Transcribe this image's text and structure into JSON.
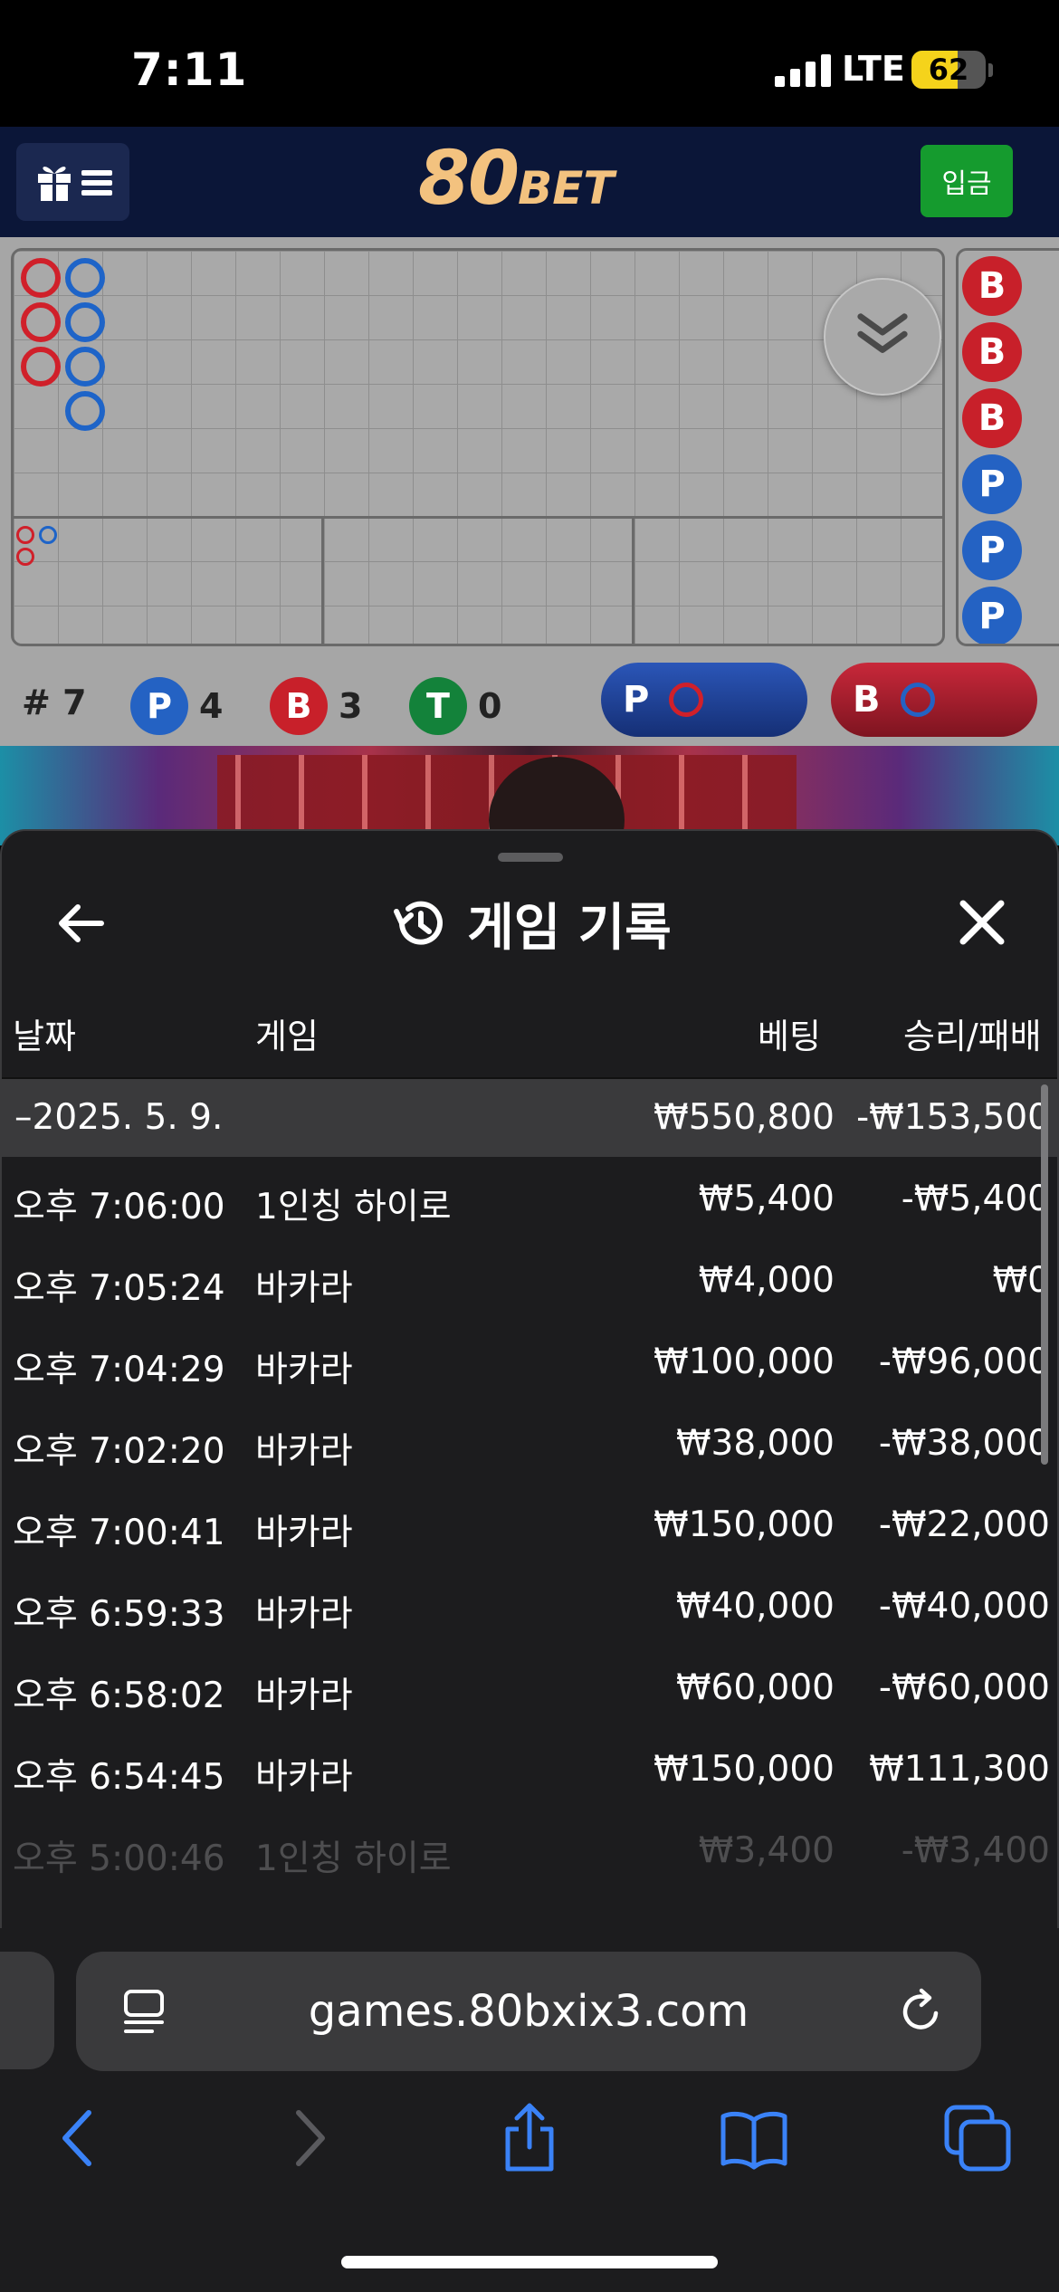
{
  "status_bar": {
    "time": "7:11",
    "network": "LTE",
    "battery": "62",
    "battery_level": 0.62
  },
  "header": {
    "logo_main": "80",
    "logo_sub": "BET",
    "deposit_label": "입금"
  },
  "roadmap": {
    "total_label": "# 7",
    "player": {
      "letter": "P",
      "count": "4"
    },
    "banker": {
      "letter": "B",
      "count": "3"
    },
    "tie": {
      "letter": "T",
      "count": "0"
    },
    "predict_player_label": "P",
    "predict_banker_label": "B",
    "bead_road": [
      "B",
      "B",
      "B",
      "P",
      "P",
      "P"
    ],
    "colors": {
      "banker": "#c8202a",
      "player": "#2462c3",
      "tie": "#13823a"
    }
  },
  "sheet": {
    "title": "게임 기록",
    "columns": {
      "date": "날짜",
      "game": "게임",
      "bet": "베팅",
      "result": "승리/패배"
    },
    "date_group": {
      "date": "–2025. 5. 9.",
      "bet": "₩550,800",
      "result": "-₩153,500"
    },
    "rows": [
      {
        "time": "오후 7:06:00",
        "game": "1인칭 하이로",
        "bet": "₩5,400",
        "result": "-₩5,400"
      },
      {
        "time": "오후 7:05:24",
        "game": "바카라",
        "bet": "₩4,000",
        "result": "₩0"
      },
      {
        "time": "오후 7:04:29",
        "game": "바카라",
        "bet": "₩100,000",
        "result": "-₩96,000"
      },
      {
        "time": "오후 7:02:20",
        "game": "바카라",
        "bet": "₩38,000",
        "result": "-₩38,000"
      },
      {
        "time": "오후 7:00:41",
        "game": "바카라",
        "bet": "₩150,000",
        "result": "-₩22,000"
      },
      {
        "time": "오후 6:59:33",
        "game": "바카라",
        "bet": "₩40,000",
        "result": "-₩40,000"
      },
      {
        "time": "오후 6:58:02",
        "game": "바카라",
        "bet": "₩60,000",
        "result": "-₩60,000"
      },
      {
        "time": "오후 6:54:45",
        "game": "바카라",
        "bet": "₩150,000",
        "result": "₩111,300"
      },
      {
        "time": "오후 5:00:46",
        "game": "1인칭 하이로",
        "bet": "₩3,400",
        "result": "-₩3,400"
      }
    ]
  },
  "browser": {
    "address": "games.80bxix3.com",
    "accent": "#3a82f7"
  }
}
